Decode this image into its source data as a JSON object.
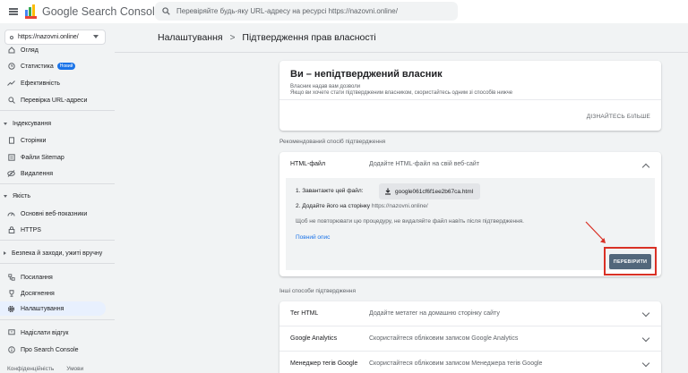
{
  "header": {
    "app_title": "Google Search Console",
    "search_placeholder": "Перевіряйте будь-яку URL-адресу на ресурсі https://nazovni.online/"
  },
  "sidebar": {
    "property": "https://nazovni.online/",
    "overview_label": "Огляд",
    "stats_label": "Статистика",
    "stats_badge": "Новий",
    "performance_label": "Ефективність",
    "url_inspection_label": "Перевірка URL-адреси",
    "indexing_section": "Індексування",
    "pages_label": "Сторінки",
    "sitemaps_label": "Файли Sitemap",
    "removals_label": "Видалення",
    "quality_section": "Якість",
    "cwv_label": "Основні веб-показники",
    "https_label": "HTTPS",
    "security_section": "Безпека й заходи, ужиті вручну",
    "links_label": "Посилання",
    "achievements_label": "Досягнення",
    "settings_label": "Налаштування",
    "feedback_label": "Надіслати відгук",
    "about_label": "Про Search Console",
    "footer_privacy": "Конфіденційність",
    "footer_terms": "Умови"
  },
  "breadcrumb": {
    "parent": "Налаштування",
    "separator": ">",
    "current": "Підтвердження прав власності"
  },
  "owner_card": {
    "title": "Ви – непідтверджений власник",
    "sub1": "Власник надав вам дозволи",
    "sub2": "Якщо ви хочете стати підтвердженим власником, скористайтесь одним зі способів нижче",
    "learn_more": "ДІЗНАЙТЕСЬ БІЛЬШЕ"
  },
  "recommended": {
    "section_label": "Рекомендований спосіб підтвердження",
    "method_title": "HTML-файл",
    "method_desc": "Додайте HTML-файл на свій веб-сайт",
    "step1_label": "1. Завантажте цей файл:",
    "download_file": "google061cf6f1ee2b67ca.html",
    "step2_label": "2. Додайте його на сторінку",
    "step2_url": "https://nazovni.online/",
    "note": "Щоб не повторювати цю процедуру, не видаляйте файл навіть після підтвердження.",
    "full_description": "Повний опис",
    "verify_button": "ПЕРЕВІРИТИ"
  },
  "other_methods": {
    "section_label": "Інші способи підтвердження",
    "items": [
      {
        "title": "Тег HTML",
        "desc": "Додайте метатег на домашню сторінку сайту"
      },
      {
        "title": "Google Analytics",
        "desc": "Скористайтеся обліковим записом Google Analytics"
      },
      {
        "title": "Менеджер тегів Google",
        "desc": "Скористайтеся обліковим записом Менеджера тегів Google"
      }
    ]
  },
  "colors": {
    "accent": "#1a73e8",
    "verify_button_bg": "#52677b",
    "highlight_border": "#d93025",
    "arrow": "#d93025"
  }
}
